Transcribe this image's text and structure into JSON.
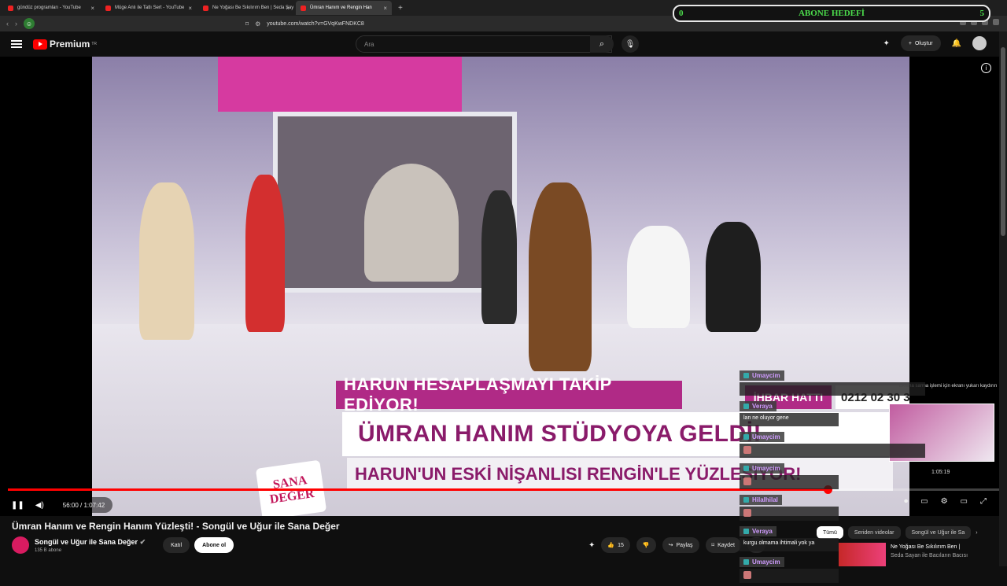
{
  "browser": {
    "tabs": [
      {
        "label": "gündüz programları - YouTube",
        "active": false
      },
      {
        "label": "Müge Anlı ile Tatlı Sert - YouTube",
        "active": false
      },
      {
        "label": "Ne Yoğası Be Sıkılırım Ben | Seda Say",
        "active": false
      },
      {
        "label": "Ümran Hanım ve Rengin Han",
        "active": true
      }
    ],
    "new_tab": "+",
    "url": "youtube.com/watch?v=GVqKwFNDKC8"
  },
  "overlay": {
    "goal_left": "0",
    "goal_title": "ABONE HEDEFİ",
    "goal_right": "5"
  },
  "header": {
    "logo": "Premium",
    "logo_sup": "TR",
    "search_placeholder": "Ara",
    "create_label": "Oluştur"
  },
  "video": {
    "tv_bar1": "HARUN HESAPLAŞMAYI TAKİP EDİYOR!",
    "tv_hotline": "İHBAR HATTI",
    "tv_phone": "0212 02 30 30",
    "tv_main": "ÜMRAN HANIM STÜDYOYA GELDİ!",
    "tv_sub": "HARUN'UN ESKİ NİŞANLISI RENGİN'LE YÜZLEŞİYOR!",
    "show_logo_1": "SANA",
    "show_logo_2": "DEĞER",
    "preview_caption": "Ekrana sarma işlemi için ekranı yukarı kaydırın",
    "preview_time": "1:05:19",
    "time_display": "56:00 / 1:07:42",
    "progress": 0.827
  },
  "chat": [
    {
      "user": "Umaycim",
      "message": "",
      "emote": false
    },
    {
      "user": "Veraya",
      "message": "lan ne oluyor gene",
      "emote": false
    },
    {
      "user": "Umaycim",
      "message": "",
      "emote": true
    },
    {
      "user": "Umaycim",
      "message": "",
      "emote": true
    },
    {
      "user": "Hilalhilal",
      "message": "",
      "emote": true
    },
    {
      "user": "Veraya",
      "message": "kurgu olmama ihtimali yok ya",
      "emote": false
    },
    {
      "user": "Umaycim",
      "message": "",
      "emote": true
    }
  ],
  "meta": {
    "title": "Ümran Hanım ve Rengin Hanım Yüzleşti! - Songül ve Uğur ile Sana Değer",
    "channel": "Songül ve Uğur ile Sana Değer",
    "subs": "135 B abone",
    "join": "Katıl",
    "subscribe": "Abone ol",
    "likes": "15",
    "share": "Paylaş",
    "save": "Kaydet"
  },
  "chips": [
    "Tümü",
    "Seriden videolar",
    "Songül ve Uğur ile Sa"
  ],
  "related": {
    "title": "Ne Yoğası Be Sıkılırım Ben |",
    "subtitle": "Seda Sayan ile Bacıların Bacısı"
  },
  "colors": {
    "accent": "#ff0000",
    "goal": "#4cdd4c",
    "tv_pink": "#b02a86"
  }
}
